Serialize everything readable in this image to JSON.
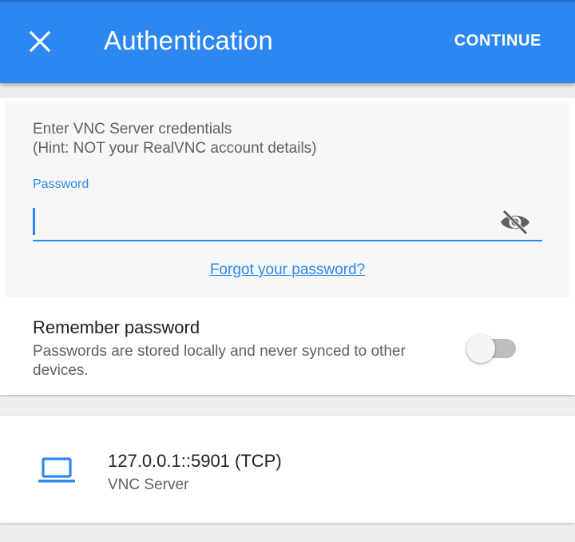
{
  "appbar": {
    "title": "Authentication",
    "continue_label": "CONTINUE",
    "close_icon": "close-icon",
    "color": "#2c88f0"
  },
  "credentials": {
    "hint_line1": "Enter VNC Server credentials",
    "hint_line2": "(Hint: NOT your RealVNC account details)",
    "password_label": "Password",
    "password_value": "",
    "visibility_icon": "eye-off-icon",
    "forgot_link": "Forgot your password?"
  },
  "remember": {
    "title": "Remember password",
    "description": "Passwords are stored locally and never synced to other devices.",
    "enabled": false
  },
  "server": {
    "icon": "laptop-icon",
    "address": "127.0.0.1::5901 (TCP)",
    "type": "VNC Server"
  }
}
